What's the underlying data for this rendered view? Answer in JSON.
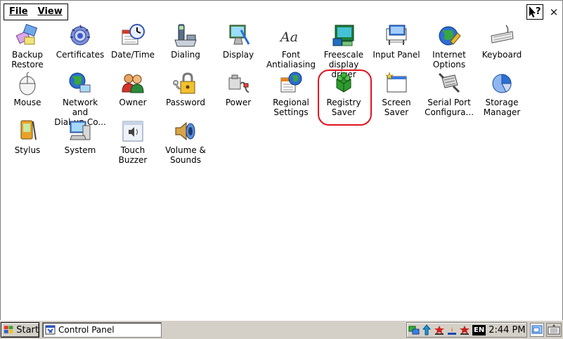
{
  "menu": {
    "file_label": "File",
    "view_label": "View"
  },
  "window": {
    "help_icon": "help-cursor-icon",
    "close_label": "×"
  },
  "items": [
    {
      "label": "Backup\nRestore",
      "icon": "backup-restore-icon"
    },
    {
      "label": "Certificates",
      "icon": "certificates-icon"
    },
    {
      "label": "Date/Time",
      "icon": "date-time-icon"
    },
    {
      "label": "Dialing",
      "icon": "dialing-icon"
    },
    {
      "label": "Display",
      "icon": "display-icon"
    },
    {
      "label": "Font\nAntialiasing",
      "icon": "font-icon"
    },
    {
      "label": "Freescale\ndisplay driver",
      "icon": "freescale-icon"
    },
    {
      "label": "Input Panel",
      "icon": "input-panel-icon"
    },
    {
      "label": "Internet\nOptions",
      "icon": "internet-options-icon"
    },
    {
      "label": "Keyboard",
      "icon": "keyboard-icon"
    },
    {
      "label": "Mouse",
      "icon": "mouse-icon"
    },
    {
      "label": "Network and\nDial-up Co...",
      "icon": "network-icon"
    },
    {
      "label": "Owner",
      "icon": "owner-icon"
    },
    {
      "label": "Password",
      "icon": "password-icon"
    },
    {
      "label": "Power",
      "icon": "power-icon"
    },
    {
      "label": "Regional\nSettings",
      "icon": "regional-settings-icon"
    },
    {
      "label": "Registry\nSaver",
      "icon": "registry-saver-icon"
    },
    {
      "label": "Screen\nSaver",
      "icon": "screen-saver-icon"
    },
    {
      "label": "Serial Port\nConfigura...",
      "icon": "serial-port-icon"
    },
    {
      "label": "Storage\nManager",
      "icon": "storage-manager-icon"
    },
    {
      "label": "Stylus",
      "icon": "stylus-icon"
    },
    {
      "label": "System",
      "icon": "system-icon"
    },
    {
      "label": "Touch\nBuzzer",
      "icon": "touch-buzzer-icon"
    },
    {
      "label": "Volume &\nSounds",
      "icon": "volume-sounds-icon"
    }
  ],
  "taskbar": {
    "start_label": "Start",
    "task_label": "Control Panel",
    "lang_badge": "EN",
    "time": "2:44 PM"
  },
  "colors": {
    "highlight_ring": "#e0141e",
    "window_bg": "#ffffff",
    "taskbar_bg": "#d4d0c8"
  }
}
